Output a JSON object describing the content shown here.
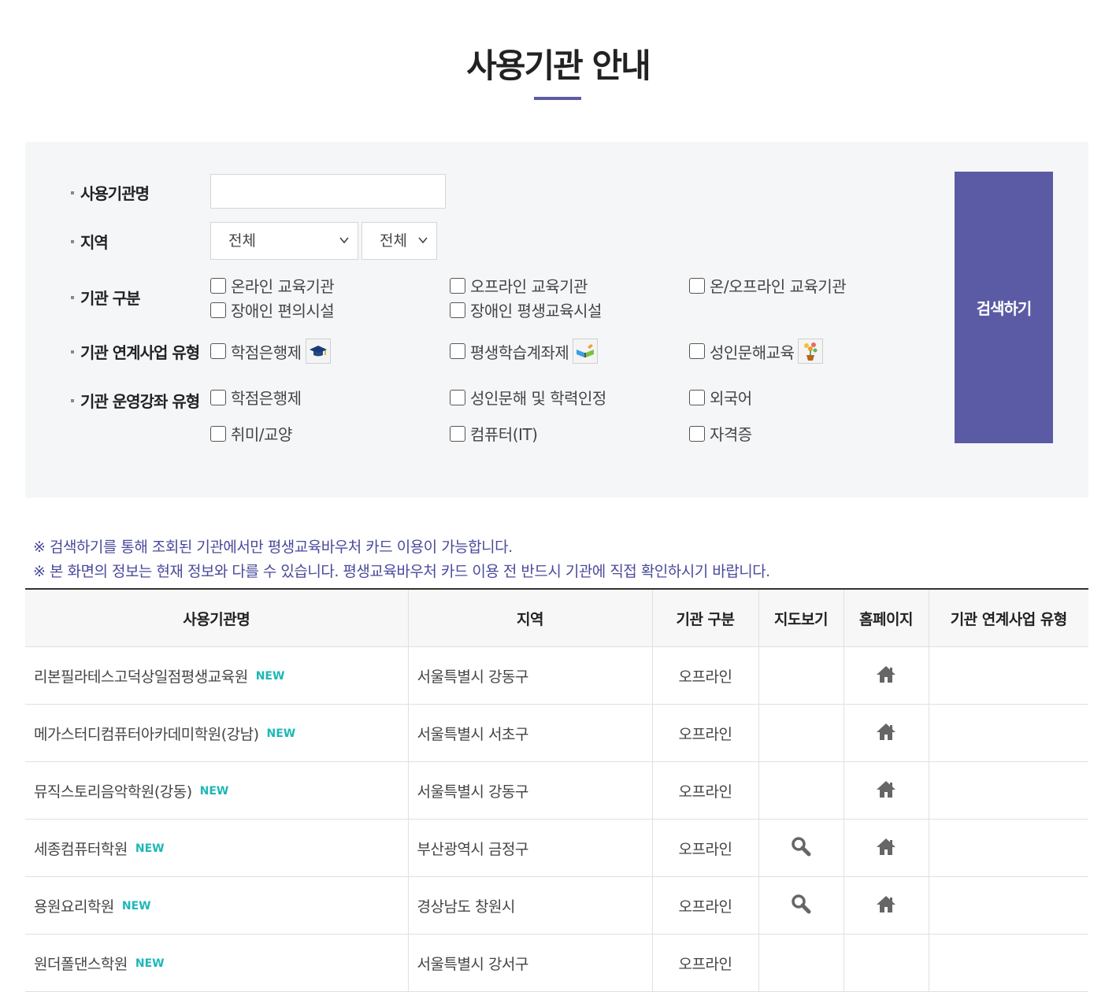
{
  "page": {
    "title": "사용기관 안내"
  },
  "filters": {
    "name_label": "사용기관명",
    "name_value": "",
    "region_label": "지역",
    "region_select1": "전체",
    "region_select2": "전체",
    "type_label": "기관 구분",
    "type_options": [
      "온라인 교육기관",
      "오프라인 교육기관",
      "온/오프라인 교육기관",
      "장애인 편의시설",
      "장애인 평생교육시설"
    ],
    "program_label": "기관 연계사업 유형",
    "program_options": [
      "학점은행제",
      "평생학습계좌제",
      "성인문해교육"
    ],
    "program_icons": [
      "graduation-cap-icon",
      "book-icon",
      "flower-pot-icon"
    ],
    "course_label": "기관 운영강좌 유형",
    "course_options": [
      "학점은행제",
      "성인문해 및 학력인정",
      "외국어",
      "취미/교양",
      "컴퓨터(IT)",
      "자격증"
    ],
    "search_button": "검색하기"
  },
  "notices": [
    "※ 검색하기를 통해 조회된 기관에서만 평생교육바우처 카드 이용이 가능합니다.",
    "※ 본 화면의 정보는 현재 정보와 다를 수 있습니다. 평생교육바우처 카드 이용 전 반드시 기관에 직접 확인하시기 바랍니다."
  ],
  "table": {
    "headers": [
      "사용기관명",
      "지역",
      "기관 구분",
      "지도보기",
      "홈페이지",
      "기관 연계사업 유형"
    ],
    "new_badge": "NEW",
    "rows": [
      {
        "name": "리본필라테스고덕상일점평생교육원",
        "region": "서울특별시 강동구",
        "type": "오프라인",
        "map": false,
        "home": true
      },
      {
        "name": "메가스터디컴퓨터아카데미학원(강남)",
        "region": "서울특별시 서초구",
        "type": "오프라인",
        "map": false,
        "home": true
      },
      {
        "name": "뮤직스토리음악학원(강동)",
        "region": "서울특별시 강동구",
        "type": "오프라인",
        "map": false,
        "home": true
      },
      {
        "name": "세종컴퓨터학원",
        "region": "부산광역시 금정구",
        "type": "오프라인",
        "map": true,
        "home": true
      },
      {
        "name": "용원요리학원",
        "region": "경상남도 창원시",
        "type": "오프라인",
        "map": true,
        "home": true
      },
      {
        "name": "원더폴댄스학원",
        "region": "서울특별시 강서구",
        "type": "오프라인",
        "map": false,
        "home": false
      }
    ]
  },
  "colors": {
    "accent": "#5b5ba5",
    "notice": "#4a4a9c",
    "new_badge": "#1eb7b7"
  }
}
